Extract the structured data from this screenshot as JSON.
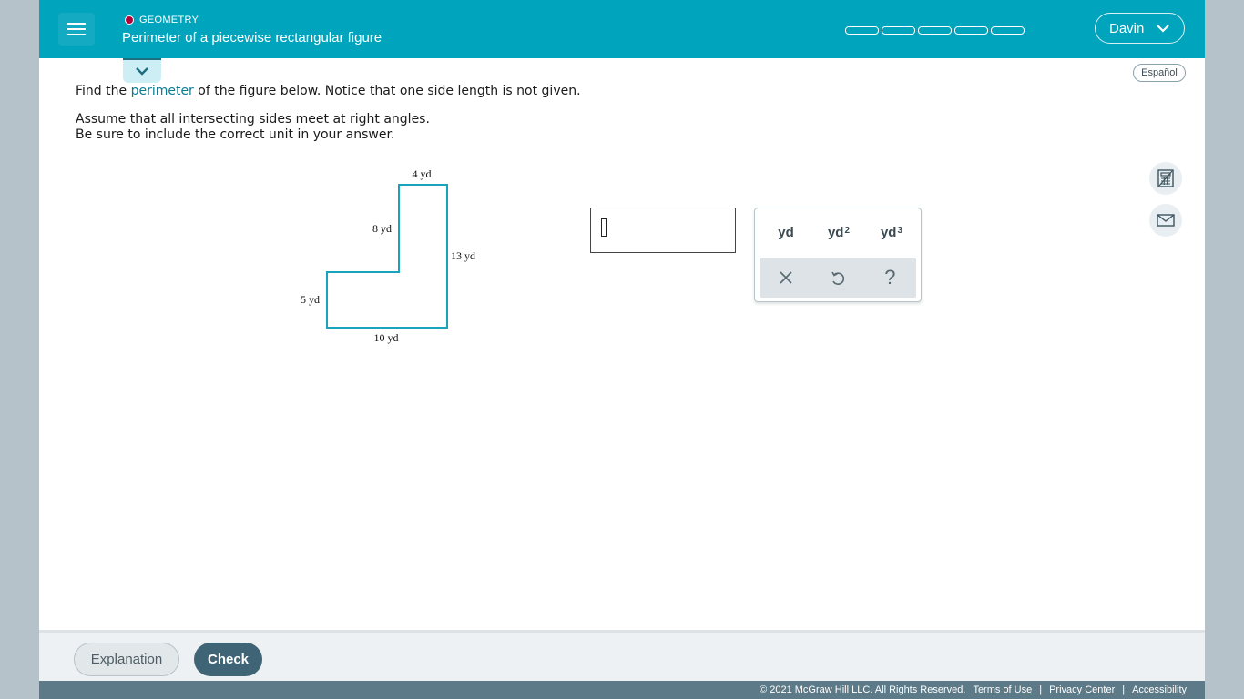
{
  "header": {
    "topic": "GEOMETRY",
    "title": "Perimeter of a piecewise rectangular figure",
    "progress_segments": 5,
    "user_name": "Davin"
  },
  "language_toggle": "Español",
  "question": {
    "line1_prefix": "Find the",
    "line1_link": "perimeter",
    "line1_suffix": "of the figure below. Notice that one side length is not given.",
    "line2": "Assume that all intersecting sides meet at right angles.",
    "line3": "Be sure to include the correct unit in your answer."
  },
  "figure": {
    "top": "4 yd",
    "inner_vertical": "8 yd",
    "right": "13 yd",
    "left": "5 yd",
    "bottom": "10 yd",
    "stroke_color": "#1aa3bd"
  },
  "answer": {
    "value": ""
  },
  "keypad": {
    "units": [
      {
        "base": "yd",
        "exp": ""
      },
      {
        "base": "yd",
        "exp": "2"
      },
      {
        "base": "yd",
        "exp": "3"
      }
    ],
    "actions": [
      "clear-icon",
      "undo-icon",
      "help-icon"
    ],
    "help_glyph": "?"
  },
  "side_tools": [
    "calculator-icon",
    "mail-icon"
  ],
  "footer": {
    "explanation_label": "Explanation",
    "check_label": "Check"
  },
  "legal": {
    "copyright": "© 2021 McGraw Hill LLC. All Rights Reserved.",
    "terms": "Terms of Use",
    "privacy": "Privacy Center",
    "accessibility": "Accessibility",
    "separator": "|"
  },
  "colors": {
    "header_bg": "#00a4bd",
    "topic_dot": "#b0003a",
    "check_button": "#3f6475",
    "legal_bar": "#5c7a88"
  }
}
